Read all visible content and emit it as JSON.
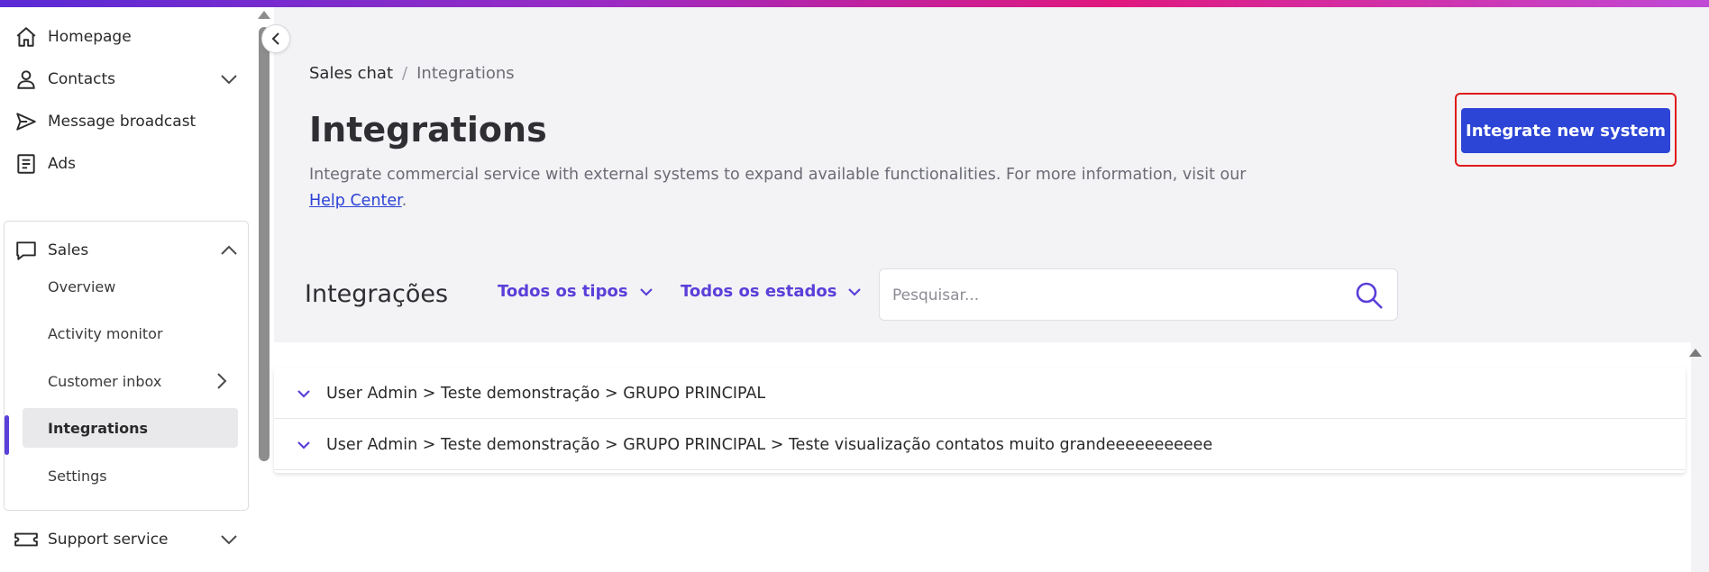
{
  "sidebar": {
    "items": [
      {
        "label": "Homepage",
        "icon": "home-icon"
      },
      {
        "label": "Contacts",
        "icon": "person-icon"
      },
      {
        "label": "Message broadcast",
        "icon": "send-icon"
      },
      {
        "label": "Ads",
        "icon": "document-icon"
      },
      {
        "label": "Sales",
        "icon": "chat-icon"
      },
      {
        "label": "Support service",
        "icon": "ticket-icon"
      }
    ],
    "sales_sub": [
      {
        "label": "Overview"
      },
      {
        "label": "Activity monitor"
      },
      {
        "label": "Customer inbox"
      },
      {
        "label": "Integrations"
      },
      {
        "label": "Settings"
      }
    ]
  },
  "breadcrumb": {
    "root": "Sales chat",
    "separator": "/",
    "current": "Integrations"
  },
  "page": {
    "title": "Integrations",
    "description": "Integrate commercial service with external systems to expand available functionalities. For more information, visit our",
    "help_link": "Help Center",
    "description_end": "."
  },
  "cta": {
    "label": "Integrate new system"
  },
  "filters": {
    "title": "Integrações",
    "types": "Todos os tipos",
    "states": "Todos os estados",
    "search_placeholder": "Pesquisar..."
  },
  "rows": [
    {
      "text": "User Admin > Teste demonstração > GRUPO PRINCIPAL"
    },
    {
      "text": "User Admin > Teste demonstração > GRUPO PRINCIPAL > Teste visualização contatos muito grandeeeeeeeeeee"
    }
  ],
  "colors": {
    "accent": "#5b3fd9",
    "primary_button": "#2c45d6",
    "highlight_outline": "#e01a1a"
  }
}
